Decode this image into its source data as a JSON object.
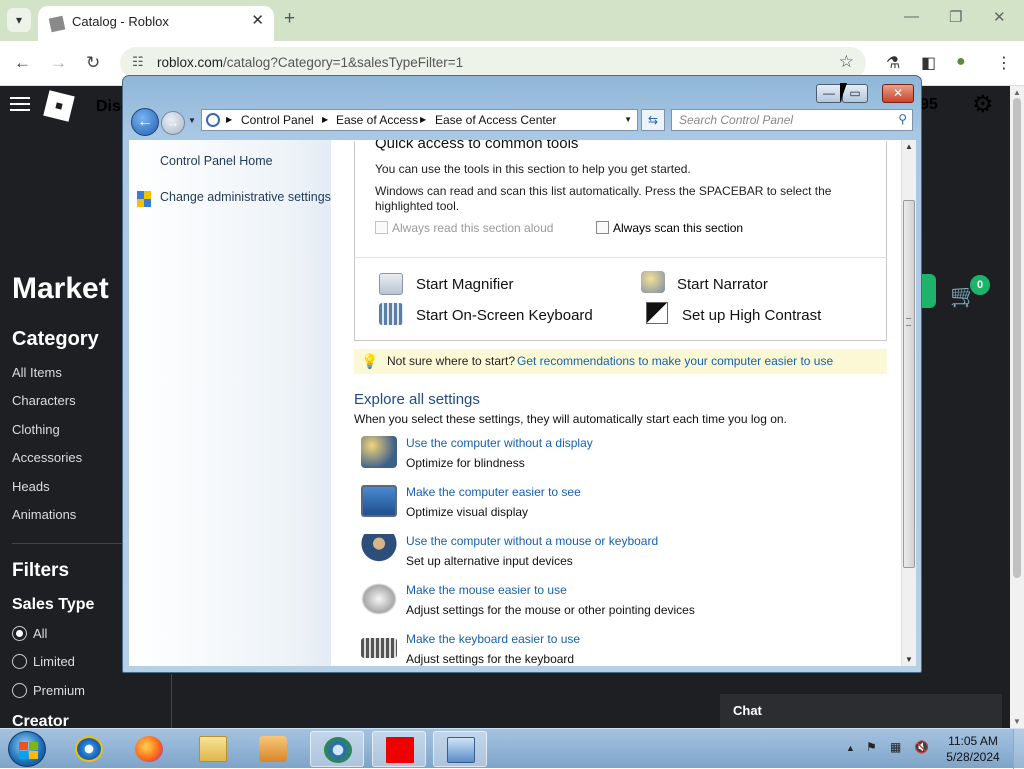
{
  "browser": {
    "tab_title": "Catalog - Roblox",
    "url_host": "roblox.com",
    "url_path": "/catalog?Category=1&salesTypeFilter=1",
    "icons": [
      "tab-search-icon",
      "close-icon",
      "new-tab-icon",
      "back-icon",
      "forward-icon",
      "reload-icon",
      "site-info-icon",
      "bookmark-star-icon",
      "labs-icon",
      "sidepanel-icon",
      "profile-icon",
      "menu-icon"
    ]
  },
  "roblox": {
    "header_partial": "Disc",
    "robux": "95",
    "title_partial": "Market",
    "category_heading": "Category",
    "categories": [
      "All Items",
      "Characters",
      "Clothing",
      "Accessories",
      "Heads",
      "Animations"
    ],
    "filters_heading": "Filters",
    "sales_type_heading": "Sales Type",
    "sales_types": [
      "All",
      "Limited",
      "Premium"
    ],
    "sales_type_selected": "All",
    "creator_heading": "Creator",
    "cart_count": "0",
    "chat_label": "Chat"
  },
  "control_panel": {
    "breadcrumb": [
      "Control Panel",
      "Ease of Access",
      "Ease of Access Center"
    ],
    "search_placeholder": "Search Control Panel",
    "side_links": [
      "Control Panel Home",
      "Change administrative settings"
    ],
    "quick_heading": "Quick access to common tools",
    "quick_intro": "You can use the tools in this section to help you get started.",
    "quick_scan_line1": "Windows can read and scan this list automatically.  Press the SPACEBAR to select the",
    "quick_scan_line2": "highlighted tool.",
    "check_read_aloud": "Always read this section aloud",
    "check_scan": "Always scan this section",
    "tools": [
      "Start Magnifier",
      "Start Narrator",
      "Start On-Screen Keyboard",
      "Set up High Contrast"
    ],
    "tip_question": "Not sure where to start?",
    "tip_link": "Get recommendations to make your computer easier to use",
    "explore_heading": "Explore all settings",
    "explore_sub": "When you select these settings, they will automatically start each time you log on.",
    "settings": [
      {
        "link": "Use the computer without a display",
        "desc": "Optimize for blindness"
      },
      {
        "link": "Make the computer easier to see",
        "desc": "Optimize visual display"
      },
      {
        "link": "Use the computer without a mouse or keyboard",
        "desc": "Set up alternative input devices"
      },
      {
        "link": "Make the mouse easier to use",
        "desc": "Adjust settings for the mouse or other pointing devices"
      },
      {
        "link": "Make the keyboard easier to use",
        "desc": "Adjust settings for the keyboard"
      }
    ]
  },
  "taskbar": {
    "apps": [
      "internet-explorer-icon",
      "firefox-icon",
      "file-explorer-icon",
      "media-player-icon",
      "ease-of-access-icon",
      "red-app-icon",
      "control-panel-icon"
    ],
    "clock_time": "11:05 AM",
    "clock_date": "5/28/2024"
  }
}
